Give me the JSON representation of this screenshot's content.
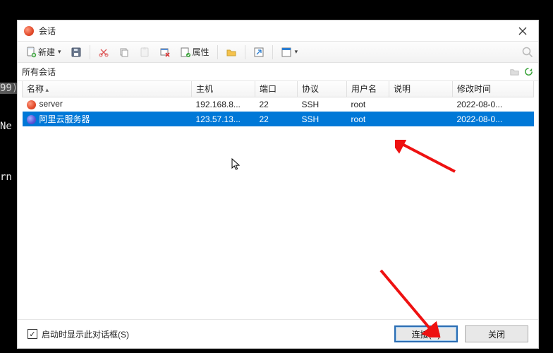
{
  "bg_terminal": {
    "line1_hl": "99)",
    "line2": "Ne",
    "line3": "rn"
  },
  "dialog": {
    "title": "会话",
    "toolbar": {
      "new_label": "新建",
      "properties_label": "属性"
    },
    "filter": {
      "label": "所有会话"
    },
    "columns": {
      "name": "名称",
      "host": "主机",
      "port": "端口",
      "protocol": "协议",
      "user": "用户名",
      "description": "说明",
      "modified": "修改时间"
    },
    "rows": [
      {
        "name": "server",
        "host": "192.168.8...",
        "port": "22",
        "protocol": "SSH",
        "user": "root",
        "description": "",
        "modified": "2022-08-0...",
        "icon": "red",
        "selected": false
      },
      {
        "name": "阿里云服务器",
        "host": "123.57.13...",
        "port": "22",
        "protocol": "SSH",
        "user": "root",
        "description": "",
        "modified": "2022-08-0...",
        "icon": "blue",
        "selected": true
      }
    ],
    "footer": {
      "show_on_start": "启动时显示此对话框(S)",
      "show_on_start_checked": true,
      "connect": "连接(C)",
      "close": "关闭"
    }
  }
}
